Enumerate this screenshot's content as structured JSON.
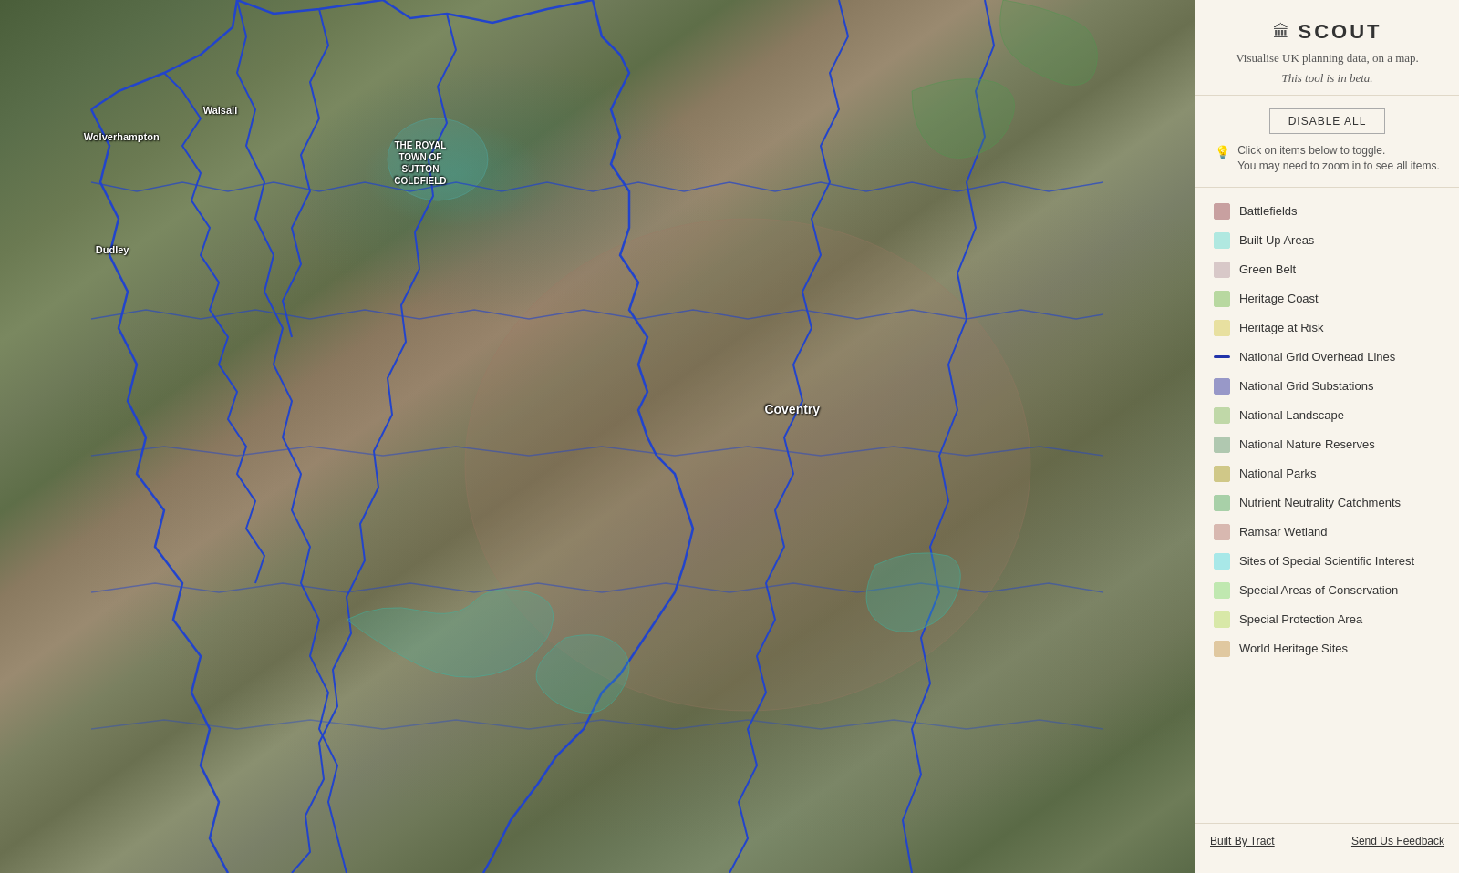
{
  "app": {
    "title": "SCOUT",
    "subtitle": "Visualise UK planning data, on a map.",
    "beta_note": "This tool is in beta.",
    "disable_all_label": "DISABLE ALL",
    "toggle_hint_line1": "Click on items below to toggle.",
    "toggle_hint_line2": "You may need to zoom in to see all items."
  },
  "legend": {
    "items": [
      {
        "id": "battlefields",
        "label": "Battlefields",
        "color": "#c8a0a0",
        "type": "fill"
      },
      {
        "id": "built-up-areas",
        "label": "Built Up Areas",
        "color": "#b0e8e0",
        "type": "fill"
      },
      {
        "id": "green-belt",
        "label": "Green Belt",
        "color": "#d8c8c8",
        "type": "fill"
      },
      {
        "id": "heritage-coast",
        "label": "Heritage Coast",
        "color": "#b8d8a0",
        "type": "fill"
      },
      {
        "id": "heritage-at-risk",
        "label": "Heritage at Risk",
        "color": "#e8e0a0",
        "type": "fill"
      },
      {
        "id": "national-grid-overhead",
        "label": "National Grid Overhead Lines",
        "color": "#2233aa",
        "type": "line"
      },
      {
        "id": "national-grid-substations",
        "label": "National Grid Substations",
        "color": "#9898c8",
        "type": "fill"
      },
      {
        "id": "national-landscape",
        "label": "National Landscape",
        "color": "#c0d8a8",
        "type": "fill"
      },
      {
        "id": "national-nature-reserves",
        "label": "National Nature Reserves",
        "color": "#b0c8b0",
        "type": "fill"
      },
      {
        "id": "national-parks",
        "label": "National Parks",
        "color": "#d0c888",
        "type": "fill"
      },
      {
        "id": "nutrient-neutrality",
        "label": "Nutrient Neutrality Catchments",
        "color": "#a8d0a8",
        "type": "fill"
      },
      {
        "id": "ramsar-wetland",
        "label": "Ramsar Wetland",
        "color": "#d8b8b0",
        "type": "fill"
      },
      {
        "id": "sssi",
        "label": "Sites of Special Scientific Interest",
        "color": "#a8e8e8",
        "type": "fill"
      },
      {
        "id": "special-areas-conservation",
        "label": "Special Areas of Conservation",
        "color": "#c0e8b0",
        "type": "fill"
      },
      {
        "id": "special-protection-area",
        "label": "Special Protection Area",
        "color": "#d8e8a8",
        "type": "fill"
      },
      {
        "id": "world-heritage",
        "label": "World Heritage Sites",
        "color": "#e0c8a0",
        "type": "fill"
      }
    ]
  },
  "footer": {
    "built_by": "Built By Tract",
    "feedback": "Send Us Feedback"
  },
  "map": {
    "town_labels": [
      {
        "label": "Wolverhampton",
        "x": "7%",
        "y": "15%"
      },
      {
        "label": "Walsall",
        "x": "17%",
        "y": "12%"
      },
      {
        "label": "Dudley",
        "x": "10%",
        "y": "28%"
      },
      {
        "label": "Coventry",
        "x": "67%",
        "y": "46%"
      },
      {
        "label": "THE ROYAL TOWN OF SUTTON COLDFIELD",
        "x": "33%",
        "y": "16%",
        "multiline": true
      }
    ]
  },
  "icons": {
    "building": "🏛",
    "lightbulb": "💡"
  }
}
